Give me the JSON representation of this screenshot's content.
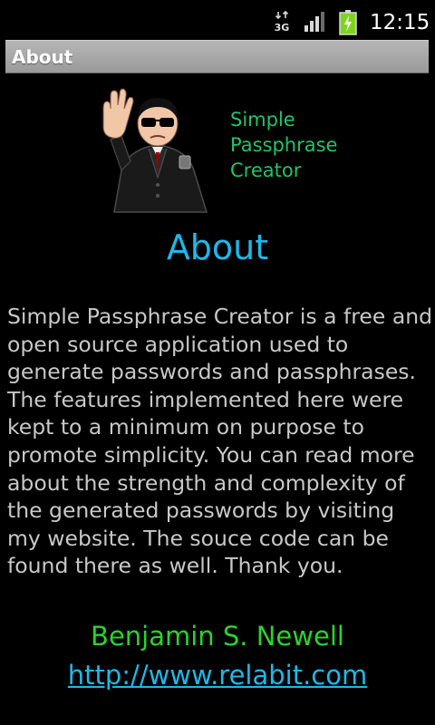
{
  "status_bar": {
    "network_label": "3G",
    "time": "12:15",
    "icons": [
      "3g-data-icon",
      "signal-strength-icon",
      "battery-charging-icon"
    ],
    "battery_color": "#7ed321"
  },
  "title_bar": {
    "title": "About"
  },
  "logo": {
    "icon": "secret-agent-icon",
    "lines": [
      "Simple",
      "Passphrase",
      "Creator"
    ],
    "color": "#1ec56a"
  },
  "main": {
    "heading": "About",
    "description": "Simple Passphrase Creator is a free and open source application used to generate passwords and passphrases. The features implemented here were kept to a minimum on purpose to promote simplicity. You can read more about the strength and complexity of the generated passwords by visiting my website. The souce code can be found there as well. Thank you.",
    "author": "Benjamin S. Newell",
    "website": "http://www.relabit.com"
  },
  "colors": {
    "accent_blue": "#1fb8e8",
    "author_green": "#2bd32b",
    "body_text": "#c8c8c8",
    "background": "#000000"
  }
}
